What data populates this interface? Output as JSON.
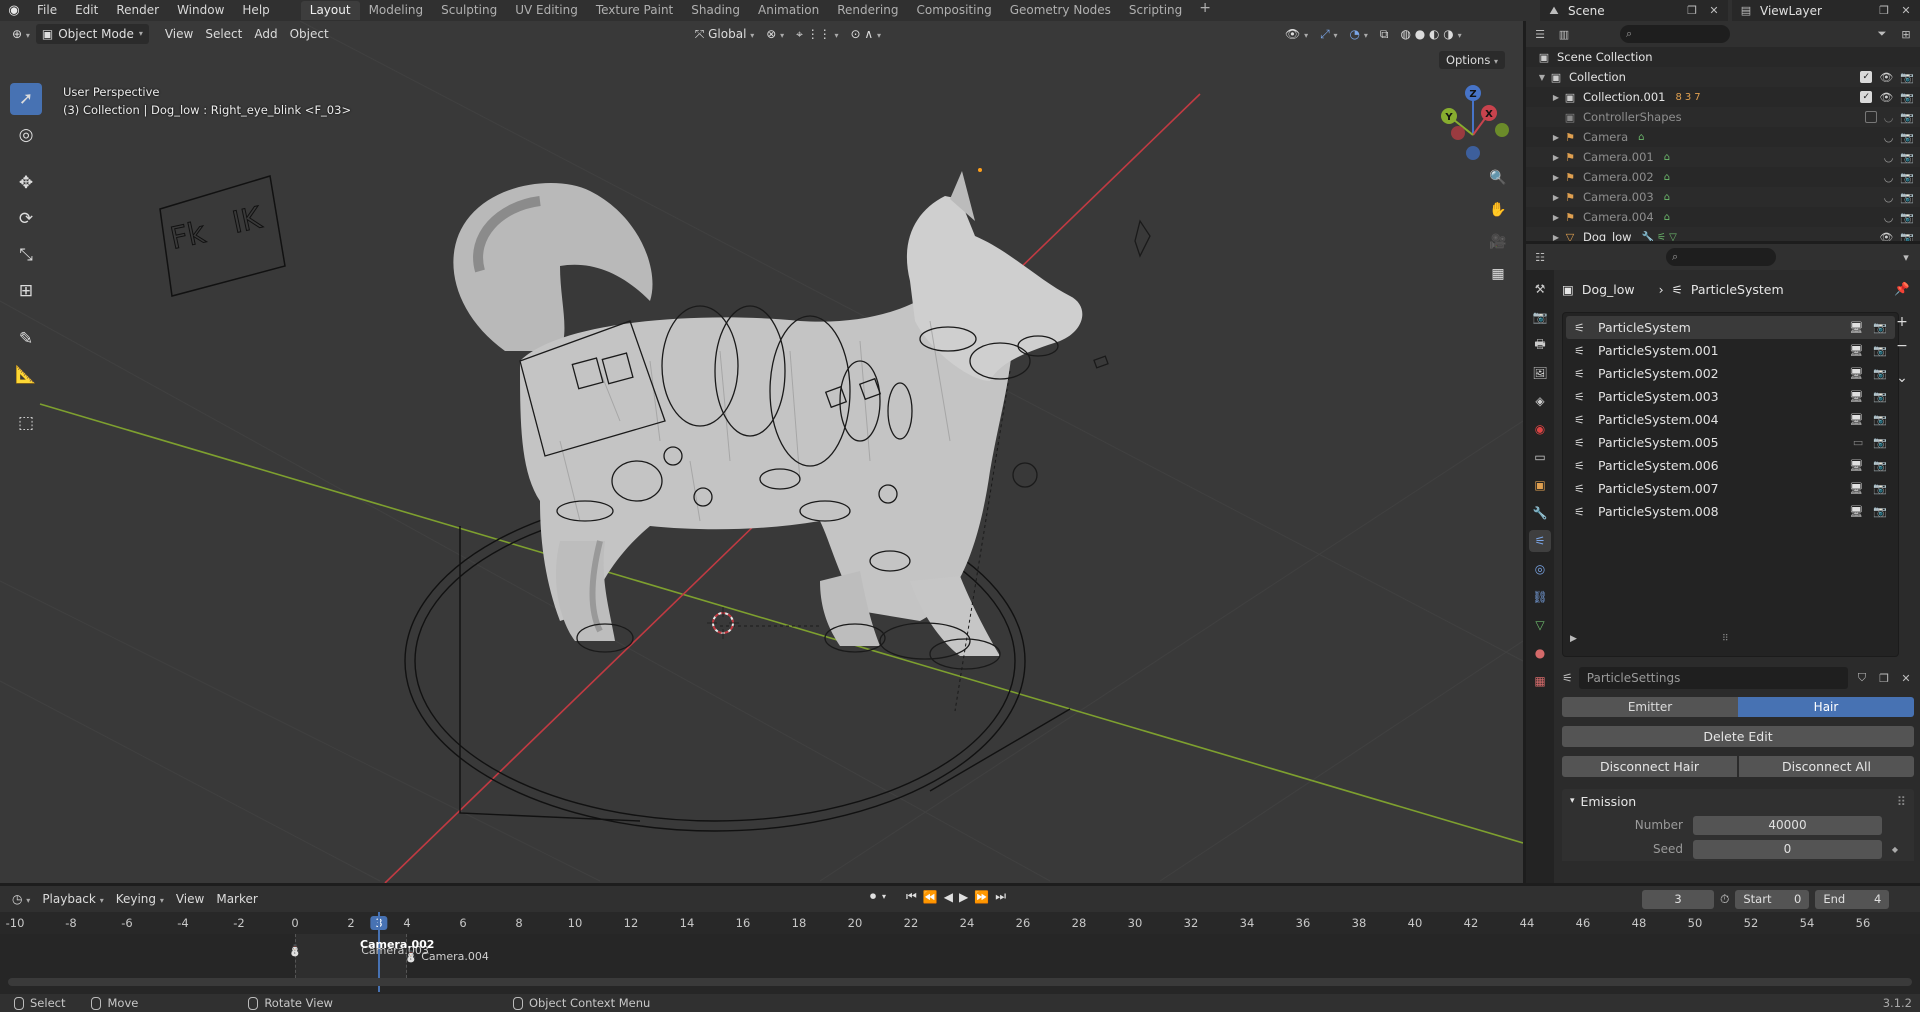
{
  "topbar": {
    "menus": [
      "File",
      "Edit",
      "Render",
      "Window",
      "Help"
    ],
    "workspaces": [
      "Layout",
      "Modeling",
      "Sculpting",
      "UV Editing",
      "Texture Paint",
      "Shading",
      "Animation",
      "Rendering",
      "Compositing",
      "Geometry Nodes",
      "Scripting"
    ],
    "active_workspace": "Layout",
    "scene_name": "Scene",
    "view_layer": "ViewLayer"
  },
  "viewport": {
    "mode": "Object Mode",
    "menus": [
      "View",
      "Select",
      "Add",
      "Object"
    ],
    "orientation": "Global",
    "options_label": "Options",
    "perspective": "User Perspective",
    "info": "(3) Collection | Dog_low : Right_eye_blink <F_03>",
    "rig_labels": [
      "Fk",
      "IK"
    ],
    "gizmo_axes": [
      "X",
      "Y",
      "Z"
    ]
  },
  "outliner": {
    "search_placeholder": "",
    "rows": [
      {
        "name": "Scene Collection",
        "icon": "scene-collection-icon"
      },
      {
        "name": "Collection",
        "icon": "collection-icon"
      },
      {
        "name": "Collection.001",
        "icon": "collection-icon",
        "tags": [
          "8",
          "3",
          "7"
        ]
      },
      {
        "name": "ControllerShapes",
        "icon": "collection-icon"
      },
      {
        "name": "Camera",
        "icon": "camera-icon"
      },
      {
        "name": "Camera.001",
        "icon": "camera-icon"
      },
      {
        "name": "Camera.002",
        "icon": "camera-icon"
      },
      {
        "name": "Camera.003",
        "icon": "camera-icon"
      },
      {
        "name": "Camera.004",
        "icon": "camera-icon"
      },
      {
        "name": "Dog_low",
        "icon": "mesh-icon"
      }
    ]
  },
  "properties": {
    "object_name": "Dog_low",
    "context_name": "ParticleSystem",
    "particle_systems": [
      {
        "name": "ParticleSystem",
        "active": true
      },
      {
        "name": "ParticleSystem.001"
      },
      {
        "name": "ParticleSystem.002"
      },
      {
        "name": "ParticleSystem.003"
      },
      {
        "name": "ParticleSystem.004"
      },
      {
        "name": "ParticleSystem.005"
      },
      {
        "name": "ParticleSystem.006"
      },
      {
        "name": "ParticleSystem.007"
      },
      {
        "name": "ParticleSystem.008"
      }
    ],
    "settings_name": "ParticleSettings",
    "type_options": [
      "Emitter",
      "Hair"
    ],
    "type_selected": "Hair",
    "delete_edit": "Delete Edit",
    "disconnect_hair": "Disconnect Hair",
    "disconnect_all": "Disconnect All",
    "emission_label": "Emission",
    "number_label": "Number",
    "number_value": "40000",
    "seed_label": "Seed",
    "seed_value": "0"
  },
  "timeline": {
    "menus": [
      "Playback",
      "Keying",
      "View",
      "Marker"
    ],
    "current_frame": "3",
    "start_label": "Start",
    "start_value": "0",
    "end_label": "End",
    "end_value": "4",
    "ruler": [
      "-10",
      "-8",
      "-6",
      "-4",
      "-2",
      "0",
      "2",
      "3",
      "4",
      "6",
      "8",
      "10",
      "12",
      "14",
      "16",
      "18",
      "20",
      "22",
      "24",
      "26",
      "28",
      "30",
      "32",
      "34",
      "36",
      "38",
      "40",
      "42",
      "44",
      "46",
      "48",
      "50",
      "52",
      "54",
      "56"
    ],
    "markers": [
      "Camera.003",
      "Camera.002",
      "Camera.004"
    ]
  },
  "statusbar": {
    "select": "Select",
    "move": "Move",
    "rotate": "Rotate View",
    "context_menu": "Object Context Menu",
    "version": "3.1.2"
  }
}
